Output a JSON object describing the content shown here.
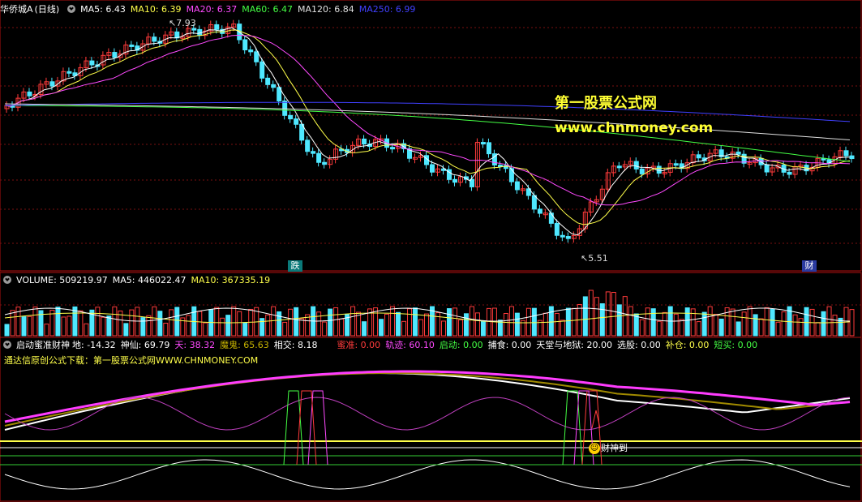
{
  "colors": {
    "up": "#ff3b3b",
    "down": "#4fe8ff",
    "ma5": "#ffffff",
    "ma10": "#ffff4a",
    "ma20": "#ff4aff",
    "ma60": "#44ff44",
    "ma120": "#e0e0e0",
    "ma250": "#4040ff",
    "grid": "#7a1010",
    "border": "#b01010"
  },
  "price_panel": {
    "stock_name": "华侨城A",
    "period": "(日线)",
    "ma5_label": "MA5: 6.43",
    "ma10_label": "MA10: 6.39",
    "ma20_label": "MA20: 6.37",
    "ma60_label": "MA60: 6.47",
    "ma120_label": "MA120: 6.84",
    "ma250_label": "MA250: 6.99",
    "high_marker": "7.93",
    "low_marker": "5.51",
    "watermark_title": "第一股票公式网",
    "watermark_url": "www.chnmoney.com",
    "signal_fall": "跌",
    "signal_wealth": "财"
  },
  "volume_panel": {
    "volume_label": "VOLUME: 509219.97",
    "ma5_label": "MA5: 446022.47",
    "ma10_label": "MA10: 367335.19"
  },
  "indicator_panel": {
    "name": "启动蜜准财神",
    "di": "地: -14.32",
    "shenxian": "神仙: 69.79",
    "tian": "天: 38.32",
    "mogui": "魔鬼: 65.63",
    "xiangjiao": "相交: 8.18",
    "mizhun": "蜜准: 0.00",
    "guiji": "轨迹: 60.10",
    "qidong": "启动: 0.00",
    "bushi": "捕食: 0.00",
    "tiantang": "天堂与地狱: 20.00",
    "xuangu": "选股: 0.00",
    "bucang": "补仓: 0.00",
    "duanmai": "短买: 0.00",
    "source_text": "通达信原创公式下载：第一股票公式网WWW.CHNMONEY.COM",
    "caishen_label": "财神到"
  }
}
